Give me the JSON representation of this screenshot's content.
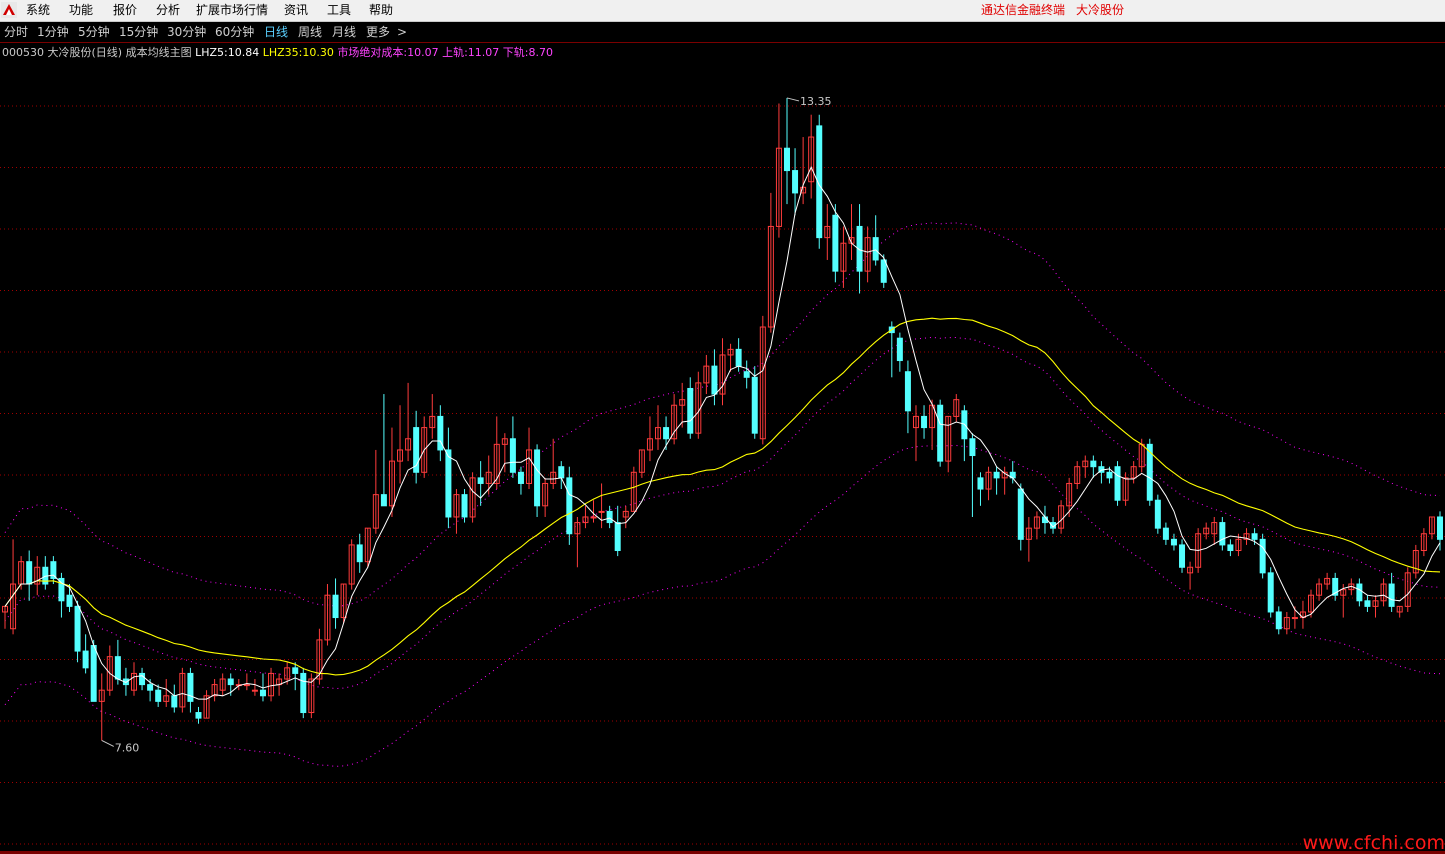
{
  "app": {
    "menus": [
      "系统",
      "功能",
      "报价",
      "分析",
      "扩展市场行情",
      "资讯",
      "工具",
      "帮助"
    ],
    "title_left": "通达信金融终端",
    "title_right": "大冷股份"
  },
  "periods": {
    "items": [
      "分时",
      "1分钟",
      "5分钟",
      "15分钟",
      "30分钟",
      "60分钟",
      "日线",
      "周线",
      "月线",
      "更多"
    ],
    "active": "日线",
    "more_arrow": ">"
  },
  "legend": {
    "stock": "000530 大冷股份(日线)",
    "indicator": "成本均线主图",
    "lhz5_label": "LHZ5:",
    "lhz5_value": "10.84",
    "lhz35_label": "LHZ35:",
    "lhz35_value": "10.30",
    "cost_label": "市场绝对成本:",
    "cost_value": "10.07",
    "upper_label": "上轨:",
    "upper_value": "11.07",
    "lower_label": "下轨:",
    "lower_value": "8.70"
  },
  "colors": {
    "up": "#ff3c3c",
    "down": "#54ffff",
    "lhz5": "#ffffff",
    "lhz35": "#ffff00",
    "band": "#ff00ff",
    "grid": "#a00000",
    "legend_stock": "#c8c8c8",
    "legend_lhz5": "#ffffff",
    "legend_lhz35": "#ffff00",
    "legend_cost": "#ff44ff"
  },
  "chart_data": {
    "type": "candlestick",
    "high_label": "13.35",
    "low_label": "7.60",
    "y_range": [
      7.3,
      13.6
    ],
    "candles": [
      [
        8.75,
        8.8,
        8.6,
        8.8
      ],
      [
        8.6,
        9.4,
        8.55,
        9.0
      ],
      [
        9.0,
        9.25,
        8.95,
        9.2
      ],
      [
        9.2,
        9.3,
        8.85,
        9.0
      ],
      [
        9.0,
        9.25,
        8.9,
        9.15
      ],
      [
        9.15,
        9.25,
        8.95,
        9.0
      ],
      [
        9.2,
        9.25,
        9.0,
        9.05
      ],
      [
        9.05,
        9.1,
        8.7,
        8.85
      ],
      [
        8.9,
        9.0,
        8.75,
        8.8
      ],
      [
        8.8,
        8.85,
        8.3,
        8.4
      ],
      [
        8.4,
        8.55,
        8.2,
        8.25
      ],
      [
        8.45,
        8.5,
        7.95,
        7.95
      ],
      [
        7.95,
        8.2,
        7.6,
        8.05
      ],
      [
        8.05,
        8.45,
        8.0,
        8.35
      ],
      [
        8.35,
        8.5,
        8.1,
        8.15
      ],
      [
        8.15,
        8.25,
        8.0,
        8.1
      ],
      [
        8.05,
        8.3,
        8.0,
        8.2
      ],
      [
        8.2,
        8.25,
        8.05,
        8.1
      ],
      [
        8.1,
        8.15,
        7.95,
        8.05
      ],
      [
        8.05,
        8.1,
        7.9,
        7.95
      ],
      [
        7.95,
        8.15,
        7.9,
        8.0
      ],
      [
        8.0,
        8.1,
        7.85,
        7.9
      ],
      [
        7.9,
        8.25,
        7.85,
        8.2
      ],
      [
        8.2,
        8.25,
        7.85,
        7.95
      ],
      [
        7.85,
        7.9,
        7.75,
        7.8
      ],
      [
        7.8,
        8.05,
        7.8,
        8.0
      ],
      [
        8.0,
        8.15,
        7.95,
        8.1
      ],
      [
        8.05,
        8.2,
        8.0,
        8.15
      ],
      [
        8.15,
        8.2,
        8.0,
        8.1
      ],
      [
        8.1,
        8.15,
        8.05,
        8.1
      ],
      [
        8.1,
        8.2,
        8.05,
        8.1
      ],
      [
        8.05,
        8.15,
        8.0,
        8.05
      ],
      [
        8.05,
        8.2,
        7.95,
        8.0
      ],
      [
        8.0,
        8.25,
        7.95,
        8.2
      ],
      [
        8.1,
        8.2,
        8.0,
        8.15
      ],
      [
        8.15,
        8.3,
        8.1,
        8.25
      ],
      [
        8.25,
        8.3,
        8.05,
        8.2
      ],
      [
        8.2,
        8.25,
        7.8,
        7.85
      ],
      [
        7.85,
        8.2,
        7.8,
        8.15
      ],
      [
        8.15,
        8.6,
        8.1,
        8.5
      ],
      [
        8.5,
        9.0,
        8.45,
        8.9
      ],
      [
        8.9,
        9.05,
        8.6,
        8.7
      ],
      [
        8.7,
        9.0,
        8.65,
        9.0
      ],
      [
        9.0,
        9.4,
        8.95,
        9.35
      ],
      [
        9.35,
        9.45,
        9.1,
        9.2
      ],
      [
        9.2,
        9.5,
        9.15,
        9.5
      ],
      [
        9.5,
        10.2,
        9.45,
        9.8
      ],
      [
        9.8,
        10.7,
        9.75,
        9.7
      ],
      [
        9.7,
        10.4,
        9.6,
        10.1
      ],
      [
        10.1,
        10.6,
        9.9,
        10.2
      ],
      [
        10.2,
        10.8,
        10.1,
        10.3
      ],
      [
        10.4,
        10.55,
        9.9,
        10.0
      ],
      [
        10.0,
        10.5,
        9.95,
        10.4
      ],
      [
        10.4,
        10.7,
        10.3,
        10.5
      ],
      [
        10.5,
        10.6,
        10.1,
        10.2
      ],
      [
        10.2,
        10.4,
        9.5,
        9.6
      ],
      [
        9.6,
        9.85,
        9.45,
        9.8
      ],
      [
        9.8,
        9.85,
        9.55,
        9.6
      ],
      [
        9.6,
        10.0,
        9.55,
        9.95
      ],
      [
        9.95,
        10.1,
        9.7,
        9.9
      ],
      [
        9.9,
        10.15,
        9.8,
        10.0
      ],
      [
        9.9,
        10.5,
        9.85,
        10.25
      ],
      [
        10.25,
        10.35,
        10.0,
        10.3
      ],
      [
        10.3,
        10.5,
        9.95,
        10.0
      ],
      [
        10.0,
        10.05,
        9.8,
        9.9
      ],
      [
        9.9,
        10.4,
        9.85,
        10.2
      ],
      [
        10.2,
        10.25,
        9.6,
        9.7
      ],
      [
        9.7,
        9.95,
        9.6,
        9.9
      ],
      [
        9.9,
        10.3,
        9.85,
        10.0
      ],
      [
        10.05,
        10.1,
        9.85,
        9.95
      ],
      [
        9.95,
        10.05,
        9.35,
        9.45
      ],
      [
        9.45,
        9.6,
        9.15,
        9.55
      ],
      [
        9.55,
        9.7,
        9.5,
        9.6
      ],
      [
        9.6,
        9.75,
        9.55,
        9.6
      ],
      [
        9.65,
        9.9,
        9.5,
        9.65
      ],
      [
        9.65,
        9.7,
        9.5,
        9.55
      ],
      [
        9.55,
        9.7,
        9.25,
        9.3
      ],
      [
        9.6,
        9.7,
        9.5,
        9.65
      ],
      [
        9.65,
        10.05,
        9.65,
        10.0
      ],
      [
        10.0,
        10.2,
        9.95,
        10.2
      ],
      [
        10.2,
        10.5,
        10.1,
        10.3
      ],
      [
        10.3,
        10.6,
        10.2,
        10.4
      ],
      [
        10.4,
        10.5,
        10.2,
        10.3
      ],
      [
        10.3,
        10.7,
        10.25,
        10.6
      ],
      [
        10.6,
        10.8,
        10.4,
        10.65
      ],
      [
        10.75,
        10.85,
        10.3,
        10.35
      ],
      [
        10.35,
        10.9,
        10.3,
        10.8
      ],
      [
        10.8,
        11.05,
        10.7,
        10.95
      ],
      [
        10.95,
        11.1,
        10.6,
        10.7
      ],
      [
        10.7,
        11.2,
        10.6,
        11.05
      ],
      [
        11.05,
        11.15,
        10.9,
        11.1
      ],
      [
        11.1,
        11.2,
        10.9,
        10.95
      ],
      [
        10.9,
        11.0,
        10.75,
        10.85
      ],
      [
        10.85,
        10.95,
        10.3,
        10.35
      ],
      [
        10.3,
        11.4,
        10.25,
        11.3
      ],
      [
        11.3,
        12.5,
        11.25,
        12.2
      ],
      [
        12.2,
        13.3,
        12.1,
        12.9
      ],
      [
        12.9,
        13.35,
        12.4,
        12.7
      ],
      [
        12.7,
        12.9,
        12.3,
        12.5
      ],
      [
        12.5,
        13.0,
        12.4,
        12.55
      ],
      [
        12.6,
        13.2,
        12.45,
        13.0
      ],
      [
        13.1,
        13.2,
        12.0,
        12.1
      ],
      [
        12.1,
        12.4,
        11.9,
        12.2
      ],
      [
        12.3,
        12.4,
        11.7,
        11.8
      ],
      [
        11.8,
        12.2,
        11.65,
        12.05
      ],
      [
        12.05,
        12.4,
        11.9,
        12.1
      ],
      [
        12.2,
        12.4,
        11.6,
        11.8
      ],
      [
        11.8,
        12.2,
        11.7,
        12.1
      ],
      [
        12.1,
        12.3,
        11.85,
        11.9
      ],
      [
        11.9,
        11.95,
        11.65,
        11.7
      ],
      [
        11.3,
        11.35,
        10.85,
        11.25
      ],
      [
        11.2,
        11.25,
        10.9,
        11.0
      ],
      [
        10.9,
        11.0,
        10.35,
        10.55
      ],
      [
        10.4,
        10.6,
        10.1,
        10.5
      ],
      [
        10.5,
        10.6,
        10.3,
        10.4
      ],
      [
        10.4,
        10.65,
        10.2,
        10.6
      ],
      [
        10.6,
        10.65,
        10.05,
        10.1
      ],
      [
        10.1,
        10.5,
        10.0,
        10.5
      ],
      [
        10.5,
        10.7,
        10.45,
        10.65
      ],
      [
        10.55,
        10.6,
        10.1,
        10.3
      ],
      [
        10.3,
        10.35,
        9.6,
        10.15
      ],
      [
        9.95,
        10.0,
        9.7,
        9.85
      ],
      [
        9.85,
        10.05,
        9.75,
        10.0
      ],
      [
        10.0,
        10.05,
        9.8,
        9.95
      ],
      [
        9.95,
        10.05,
        9.8,
        10.0
      ],
      [
        10.0,
        10.1,
        9.9,
        9.95
      ],
      [
        9.85,
        9.9,
        9.3,
        9.4
      ],
      [
        9.4,
        9.6,
        9.2,
        9.5
      ],
      [
        9.5,
        9.65,
        9.4,
        9.6
      ],
      [
        9.6,
        9.7,
        9.45,
        9.55
      ],
      [
        9.55,
        9.6,
        9.45,
        9.5
      ],
      [
        9.5,
        9.75,
        9.45,
        9.7
      ],
      [
        9.7,
        9.95,
        9.6,
        9.9
      ],
      [
        9.9,
        10.1,
        9.85,
        10.05
      ],
      [
        10.05,
        10.15,
        9.95,
        10.1
      ],
      [
        10.1,
        10.15,
        9.95,
        10.05
      ],
      [
        10.05,
        10.1,
        9.9,
        10.0
      ],
      [
        10.0,
        10.05,
        9.9,
        9.95
      ],
      [
        10.05,
        10.1,
        9.7,
        9.75
      ],
      [
        9.75,
        10.0,
        9.7,
        9.95
      ],
      [
        9.95,
        10.1,
        9.9,
        10.05
      ],
      [
        10.05,
        10.3,
        10.0,
        10.25
      ],
      [
        10.25,
        10.3,
        9.7,
        9.75
      ],
      [
        9.75,
        9.8,
        9.45,
        9.5
      ],
      [
        9.5,
        9.55,
        9.35,
        9.4
      ],
      [
        9.4,
        9.45,
        9.3,
        9.35
      ],
      [
        9.35,
        9.4,
        9.1,
        9.15
      ],
      [
        9.1,
        9.2,
        8.95,
        9.15
      ],
      [
        9.15,
        9.5,
        9.1,
        9.45
      ],
      [
        9.45,
        9.55,
        9.4,
        9.5
      ],
      [
        9.45,
        9.6,
        9.35,
        9.55
      ],
      [
        9.55,
        9.6,
        9.3,
        9.35
      ],
      [
        9.35,
        9.4,
        9.25,
        9.3
      ],
      [
        9.3,
        9.45,
        9.25,
        9.4
      ],
      [
        9.4,
        9.5,
        9.35,
        9.45
      ],
      [
        9.45,
        9.5,
        9.35,
        9.4
      ],
      [
        9.4,
        9.45,
        9.05,
        9.1
      ],
      [
        9.1,
        9.15,
        8.7,
        8.75
      ],
      [
        8.75,
        8.8,
        8.55,
        8.6
      ],
      [
        8.6,
        8.75,
        8.55,
        8.7
      ],
      [
        8.7,
        8.8,
        8.6,
        8.7
      ],
      [
        8.7,
        8.85,
        8.6,
        8.75
      ],
      [
        8.75,
        8.95,
        8.7,
        8.9
      ],
      [
        8.9,
        9.05,
        8.85,
        9.0
      ],
      [
        9.0,
        9.1,
        8.95,
        9.05
      ],
      [
        9.05,
        9.1,
        8.85,
        8.9
      ],
      [
        8.9,
        9.0,
        8.7,
        8.95
      ],
      [
        8.95,
        9.05,
        8.9,
        9.0
      ],
      [
        9.0,
        9.05,
        8.8,
        8.85
      ],
      [
        8.85,
        8.9,
        8.75,
        8.8
      ],
      [
        8.8,
        8.9,
        8.7,
        8.85
      ],
      [
        8.85,
        9.05,
        8.8,
        9.0
      ],
      [
        9.0,
        9.1,
        8.75,
        8.8
      ],
      [
        8.75,
        8.8,
        8.7,
        8.8
      ],
      [
        8.8,
        9.15,
        8.75,
        9.1
      ],
      [
        9.1,
        9.35,
        9.05,
        9.3
      ],
      [
        9.3,
        9.5,
        9.25,
        9.45
      ],
      [
        9.45,
        9.6,
        9.4,
        9.6
      ],
      [
        9.6,
        9.65,
        9.3,
        9.4
      ]
    ]
  }
}
